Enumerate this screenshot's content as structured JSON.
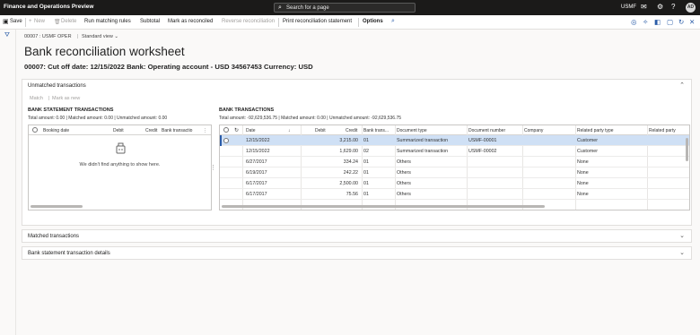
{
  "app": {
    "title": "Finance and Operations Preview",
    "search_placeholder": "Search for a page",
    "company": "USMF",
    "user_initials": "AD"
  },
  "toolbar": {
    "save": "Save",
    "new": "New",
    "delete": "Delete",
    "run_matching_rules": "Run matching rules",
    "subtotal": "Subtotal",
    "mark_as_reconciled": "Mark as reconciled",
    "reverse_reconciliation": "Reverse reconciliation",
    "print_statement": "Print reconciliation statement",
    "options": "Options"
  },
  "breadcrumb": {
    "entity": "00007 : USMF OPER",
    "view": "Standard view"
  },
  "page": {
    "title": "Bank reconciliation worksheet",
    "subtitle": "00007: Cut off date: 12/15/2022 Bank: Operating account - USD 34567453 Currency: USD"
  },
  "unmatched": {
    "title": "Unmatched transactions",
    "match": "Match",
    "mark_as_new": "Mark as new",
    "statement": {
      "title": "BANK STATEMENT TRANSACTIONS",
      "totals": "Total amount: 0.00 | Matched amount: 0.00 | Unmatched amount: 0.00",
      "columns": [
        "Booking date",
        "Debit",
        "Credit",
        "Bank transactio"
      ],
      "empty_message": "We didn't find anything to show here."
    },
    "bank": {
      "title": "BANK TRANSACTIONS",
      "totals": "Total amount: -92,629,536.75 | Matched amount: 0.00 | Unmatched amount: -92,629,536.75",
      "columns": [
        "Date",
        "Debit",
        "Credit",
        "Bank trans...",
        "Document type",
        "Document number",
        "Company",
        "Related party type",
        "Related party"
      ],
      "rows": [
        {
          "date": "12/15/2022",
          "debit": "3,215.00",
          "credit": "",
          "bank_trans": "01",
          "doc_type": "Summarized transaction",
          "doc_number": "USMF-00001",
          "company": "",
          "party_type": "Customer",
          "party": ""
        },
        {
          "date": "12/15/2022",
          "debit": "1,629.00",
          "credit": "",
          "bank_trans": "02",
          "doc_type": "Summarized transaction",
          "doc_number": "USMF-00002",
          "company": "",
          "party_type": "Customer",
          "party": ""
        },
        {
          "date": "6/27/2017",
          "debit": "334.24",
          "credit": "",
          "bank_trans": "01",
          "doc_type": "Others",
          "doc_number": "",
          "company": "",
          "party_type": "None",
          "party": ""
        },
        {
          "date": "6/19/2017",
          "debit": "242.22",
          "credit": "",
          "bank_trans": "01",
          "doc_type": "Others",
          "doc_number": "",
          "company": "",
          "party_type": "None",
          "party": ""
        },
        {
          "date": "6/17/2017",
          "debit": "2,500.00",
          "credit": "",
          "bank_trans": "01",
          "doc_type": "Others",
          "doc_number": "",
          "company": "",
          "party_type": "None",
          "party": ""
        },
        {
          "date": "6/17/2017",
          "debit": "75.56",
          "credit": "",
          "bank_trans": "01",
          "doc_type": "Others",
          "doc_number": "",
          "company": "",
          "party_type": "None",
          "party": ""
        }
      ]
    }
  },
  "matched": {
    "title": "Matched transactions"
  },
  "details": {
    "title": "Bank statement transaction details"
  }
}
